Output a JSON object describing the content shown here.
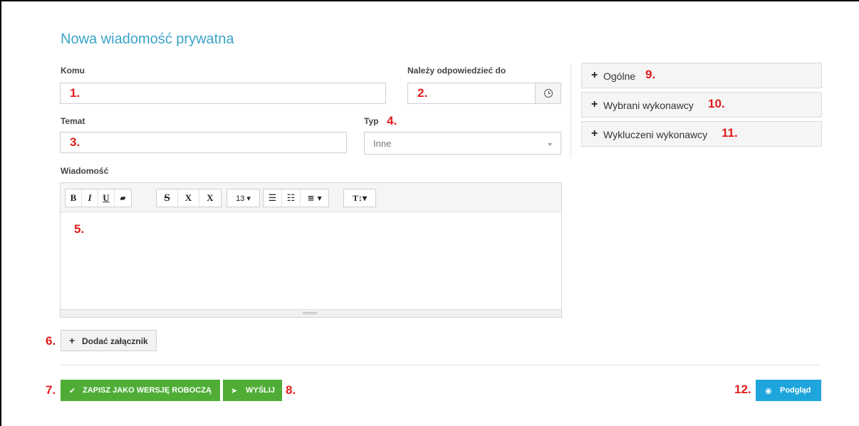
{
  "page_title": "Nowa wiadomość prywatna",
  "fields": {
    "komu_label": "Komu",
    "nalezy_label": "Należy odpowiedzieć do",
    "temat_label": "Temat",
    "typ_label": "Typ",
    "typ_value": "Inne",
    "wiadomosc_label": "Wiadomość"
  },
  "toolbar": {
    "bold": "B",
    "italic": "I",
    "underline": "U",
    "eraser": "▰",
    "strike": "S",
    "superscript": "X",
    "subscript": "X",
    "font_size": "13 ▾",
    "unordered_list": "☰",
    "ordered_list": "☷",
    "align": "≡ ▾",
    "text_style": "T↕▾"
  },
  "sidebar": {
    "panels": [
      {
        "label": "Ogólne",
        "marker": "9."
      },
      {
        "label": "Wybrani wykonawcy",
        "marker": "10."
      },
      {
        "label": "Wykluczeni wykonawcy",
        "marker": "11."
      }
    ]
  },
  "buttons": {
    "attach_label": "Dodać załącznik",
    "draft_label": "ZAPISZ JAKO WERSJĘ ROBOCZĄ",
    "send_label": "WYŚLIJ",
    "preview_label": "Podgląd"
  },
  "markers": {
    "m1": "1.",
    "m2": "2.",
    "m3": "3.",
    "m4": "4.",
    "m5": "5.",
    "m6": "6.",
    "m7": "7.",
    "m8": "8.",
    "m12": "12."
  },
  "icons": {
    "plus": "+",
    "check": "✔",
    "send": "➤",
    "eye": "◉",
    "clock": "clock-icon",
    "caret": "chevron-down-icon"
  },
  "colors": {
    "title": "#3aa3c9",
    "marker": "#e21c1c",
    "primary_green": "#4fad36",
    "preview_blue": "#1ea5dc"
  }
}
